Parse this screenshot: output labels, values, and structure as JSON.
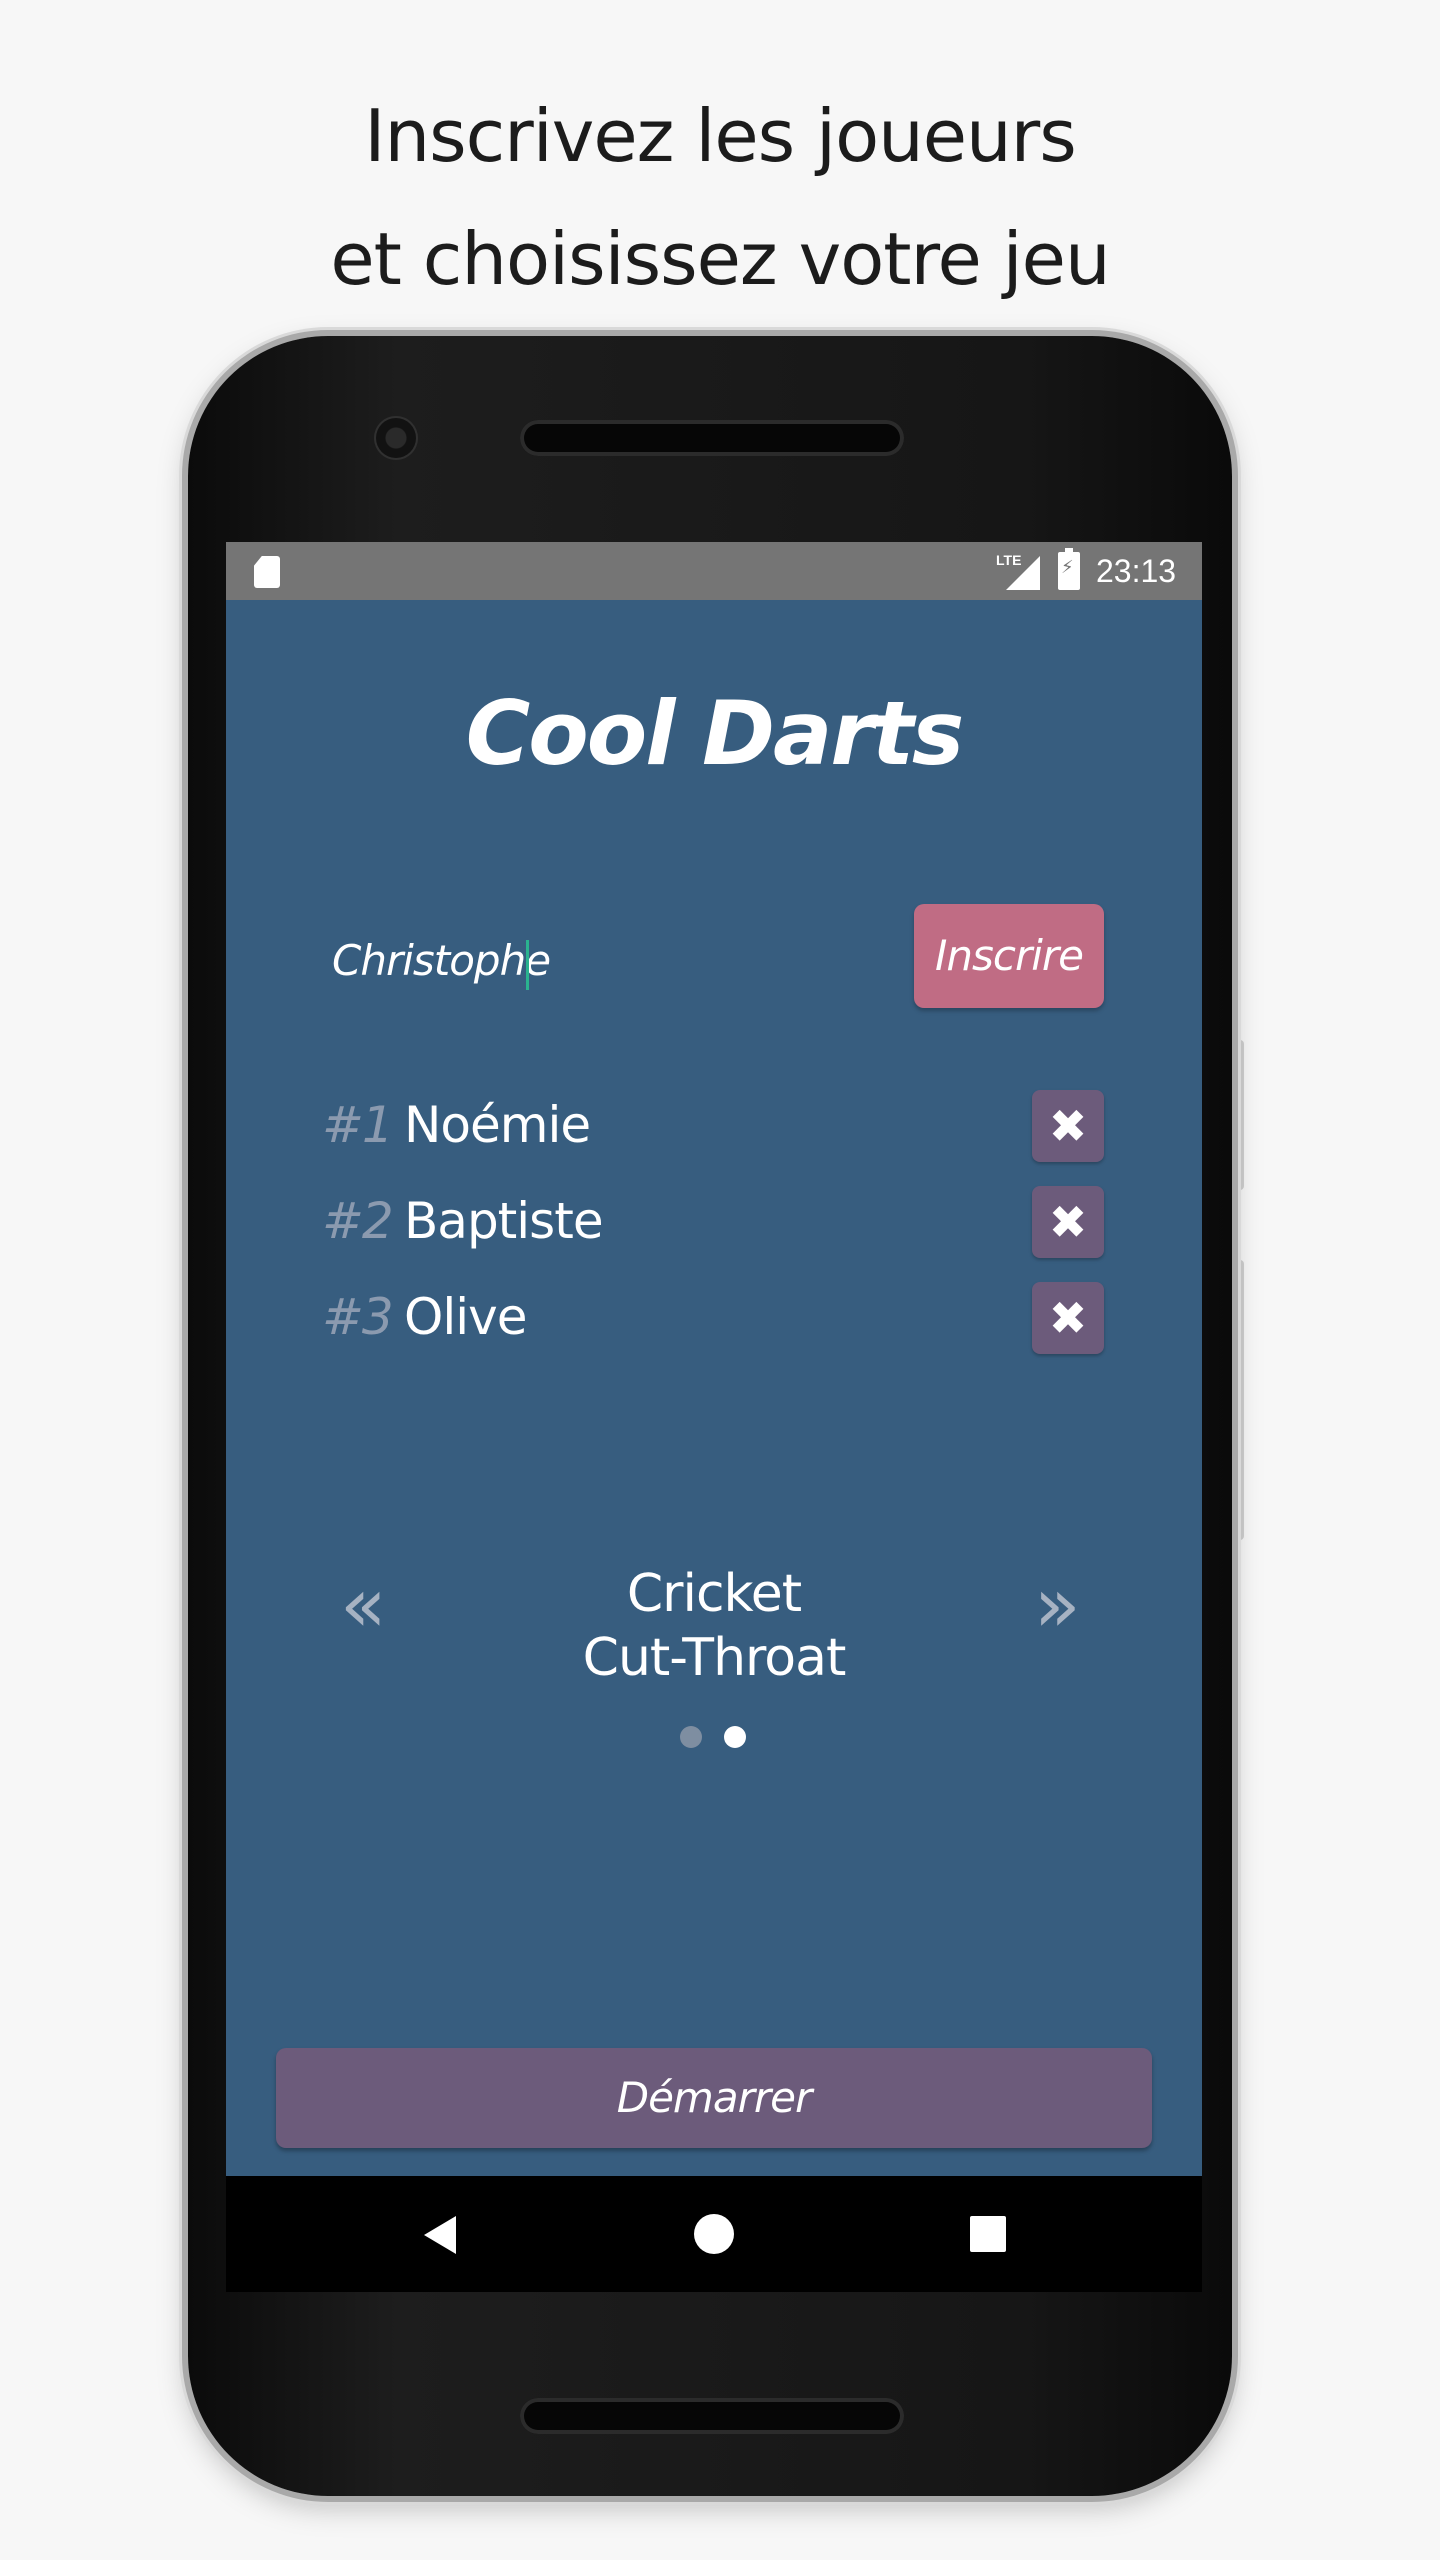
{
  "caption": {
    "line1": "Inscrivez les joueurs",
    "line2": "et choisissez votre jeu"
  },
  "statusbar": {
    "network": "LTE",
    "time": "23:13",
    "icons": [
      "sd-card-icon",
      "lte-signal-icon",
      "battery-charging-icon"
    ]
  },
  "app": {
    "title": "Cool Darts",
    "name_input_value": "Christophe",
    "register_label": "Inscrire",
    "players": [
      {
        "number": "#1",
        "name": "Noémie"
      },
      {
        "number": "#2",
        "name": "Baptiste"
      },
      {
        "number": "#3",
        "name": "Olive"
      }
    ],
    "remove_icon": "✖",
    "game_selector": {
      "prev_icon": "«",
      "next_icon": "»",
      "line1": "Cricket",
      "line2": "Cut-Throat",
      "pages": 2,
      "active_page": 2
    },
    "start_label": "Démarrer"
  },
  "colors": {
    "screen_bg": "#375d7f",
    "register_btn": "#c06c84",
    "accent_purple": "#6c5b7b",
    "caret": "#2ab38f"
  }
}
